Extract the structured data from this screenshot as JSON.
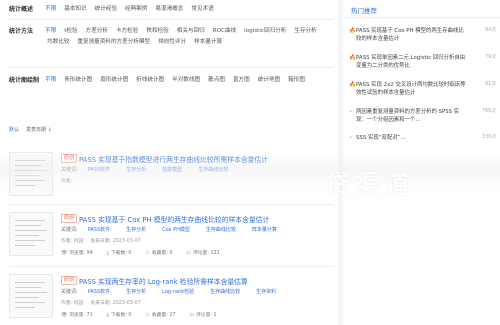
{
  "top_tabs": {
    "label": "统计概述",
    "options": [
      "不限",
      "基本知识",
      "统计经验",
      "经典案例",
      "易混淆概念",
      "常见术语"
    ]
  },
  "methods": {
    "label": "统计方法",
    "options": [
      "不限",
      "t检验",
      "方差分析",
      "卡方检验",
      "秩和检验",
      "相关与回归",
      "ROC曲线",
      "logistic回归分析",
      "生存分析",
      "均数比较",
      "重复测量资料的方差分析模型",
      "倾向性评分",
      "样本量计算"
    ]
  },
  "charts": {
    "label": "统计图绘制",
    "options": [
      "不限",
      "条形统计图",
      "扇形统计图",
      "折线统计图",
      "半对数线图",
      "散点图",
      "直方图",
      "统计地图",
      "箱形图"
    ]
  },
  "sort": {
    "options": [
      "默认",
      "发表日期 ↓"
    ]
  },
  "items": [
    {
      "tag": "原创",
      "title": "PASS 实现基于指数模型进行两生存曲线比较所需样本含量估计",
      "keywords_label": "关键词:",
      "keywords": [
        "PASS软件",
        "生存分析",
        "指数模型",
        "生存曲线比较"
      ],
      "author_label": "作者:",
      "author": "",
      "date": "",
      "views": "",
      "downloads": "",
      "favorites": "",
      "comments": ""
    },
    {
      "tag": "原创",
      "title": "PASS 实现基于 Cox PH 模型的两生存曲线比较的样本含量估计",
      "keywords_label": "关键词:",
      "keywords": [
        "PASS软件",
        "生存分析",
        "Cox PH模型",
        "生存曲线比较",
        "样本量计算"
      ],
      "author_label": "作者:",
      "author": "何园",
      "date_label": "发表日期:",
      "date": "2023-03-07",
      "views_label": "浏览量:",
      "views": "94",
      "downloads_label": "下载数:",
      "downloads": "0",
      "favorites_label": "收藏量:",
      "favorites": "0",
      "comments_label": "评论量:",
      "comments": "131"
    },
    {
      "tag": "原创",
      "title": "PASS 实现两生存率的 Log-rank 检验所需样本含量估算",
      "keywords_label": "关键词:",
      "keywords": [
        "PASS软件",
        "生存分析",
        "Log-rank检验",
        "生存曲线比较",
        "生存资料"
      ],
      "author_label": "作者:",
      "author": "何园",
      "date_label": "发表日期:",
      "date": "2023-03-07",
      "views_label": "浏览量:",
      "views": "71",
      "downloads_label": "下载数:",
      "downloads": "0",
      "favorites_label": "收藏量:",
      "favorites": "27",
      "comments_label": "评论量:",
      "comments": "1"
    }
  ],
  "side": {
    "title": "热门推荐",
    "hot": [
      {
        "text": "PASS 实现基于 Cox PH 模型的两生存曲线比较的样本含量估计",
        "views": "94次"
      },
      {
        "text": "PASS 实现单因素二元 Logistic 回归分析自由变量为二分类的优势比",
        "views": "79次"
      },
      {
        "text": "PASS 实现 2x2 交叉设计两均数比较时临床等效性试验的样本含量估计",
        "views": "61次"
      },
      {
        "text": "两因素重复测量资料的方差分析的 SPSS 实现：一个分组因素和一个...",
        "views": "766次"
      },
      {
        "text": "SSS 实现“双配对”...",
        "views": "330次"
      }
    ]
  },
  "watermark": "贷渠道"
}
